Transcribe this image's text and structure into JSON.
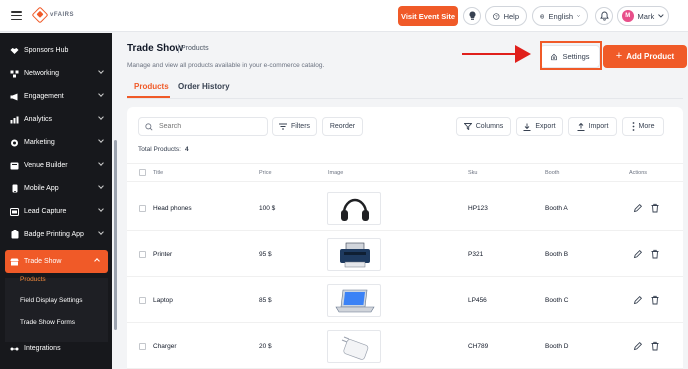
{
  "header": {
    "logo_text": "vFAIRS",
    "visit_button": "Visit Event Site",
    "help_label": "Help",
    "language": "English",
    "user_initial": "M",
    "user_name": "Mark",
    "accent_color": "#f05a28"
  },
  "sidebar": {
    "items": [
      {
        "label": "Sponsors Hub",
        "icon": "handshake-icon"
      },
      {
        "label": "Networking",
        "icon": "network-icon"
      },
      {
        "label": "Engagement",
        "icon": "megaphone-icon"
      },
      {
        "label": "Analytics",
        "icon": "analytics-icon"
      },
      {
        "label": "Marketing",
        "icon": "marketing-icon"
      },
      {
        "label": "Venue Builder",
        "icon": "venue-icon"
      },
      {
        "label": "Mobile App",
        "icon": "mobile-icon"
      },
      {
        "label": "Lead Capture",
        "icon": "lead-capture-icon"
      },
      {
        "label": "Badge Printing App",
        "icon": "badge-icon"
      },
      {
        "label": "Trade Show",
        "icon": "trade-show-icon"
      },
      {
        "label": "Integrations",
        "icon": "integrations-icon"
      }
    ],
    "sub_items": [
      "Products",
      "Field Display Settings",
      "Trade Show Forms"
    ]
  },
  "page": {
    "title": "Trade Show",
    "crumb": "Products",
    "description": "Manage and view all products available in your e-commerce catalog.",
    "settings_label": "Settings",
    "add_label": "Add Product",
    "tabs": [
      "Products",
      "Order History"
    ]
  },
  "toolbar": {
    "search_placeholder": "Search",
    "filters": "Filters",
    "reorder": "Reorder",
    "columns": "Columns",
    "export": "Export",
    "import": "Import",
    "more": "More"
  },
  "table": {
    "total_label": "Total Products:",
    "total_count": "4",
    "headers": [
      "Title",
      "Price",
      "Image",
      "Sku",
      "Booth",
      "Actions"
    ],
    "rows": [
      {
        "title": "Head phones",
        "price": "100 $",
        "image": "headphones",
        "sku": "HP123",
        "booth": "Booth A"
      },
      {
        "title": "Printer",
        "price": "95 $",
        "image": "printer",
        "sku": "P321",
        "booth": "Booth B"
      },
      {
        "title": "Laptop",
        "price": "85 $",
        "image": "laptop",
        "sku": "LP456",
        "booth": "Booth C"
      },
      {
        "title": "Charger",
        "price": "20 $",
        "image": "charger",
        "sku": "CH789",
        "booth": "Booth D"
      }
    ]
  }
}
